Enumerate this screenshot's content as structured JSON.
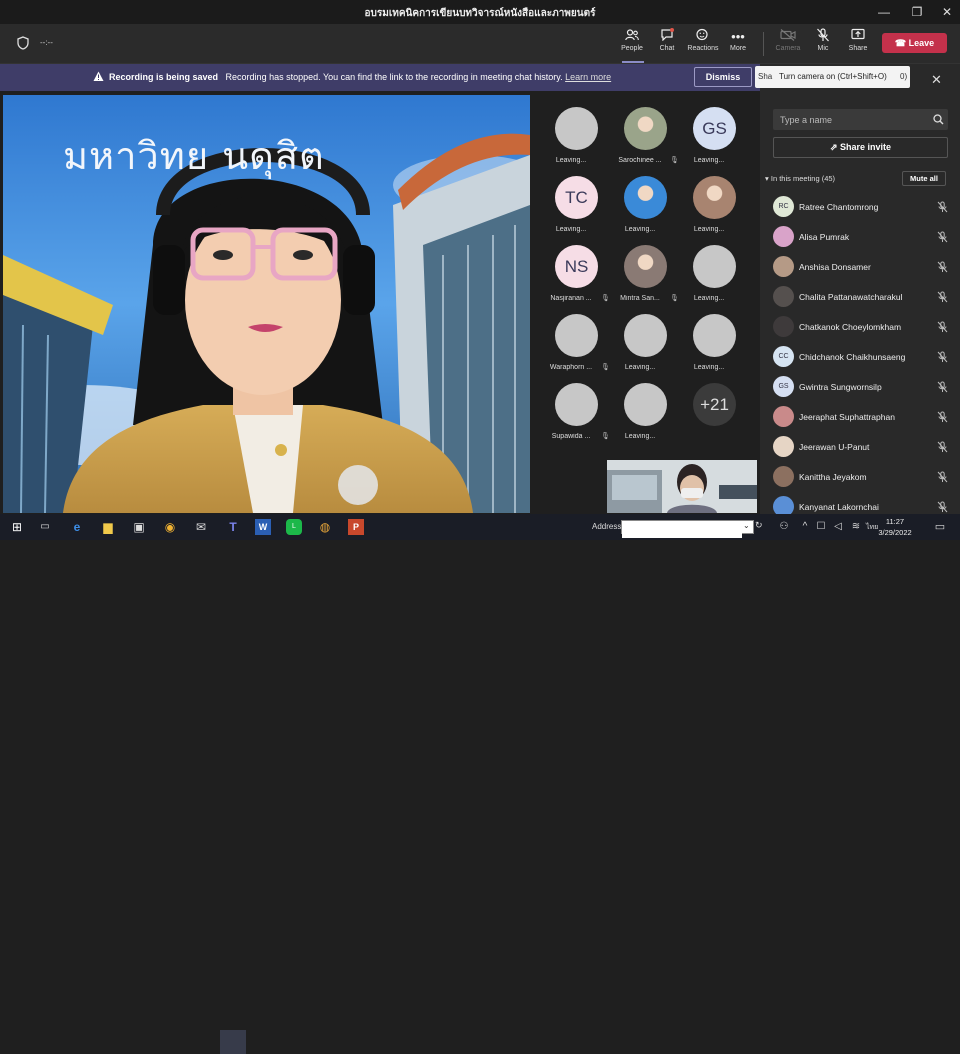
{
  "window": {
    "title": "อบรมเทคนิคการเขียนบทวิจารณ์หนังสือและภาพยนตร์",
    "minimize_glyph": "—",
    "maximize_glyph": "❐",
    "close_glyph": "✕"
  },
  "toolbar": {
    "timer": "--:--",
    "people_label": "People",
    "chat_label": "Chat",
    "reactions_label": "Reactions",
    "more_label": "More",
    "camera_label": "Camera",
    "mic_label": "Mic",
    "share_label": "Share",
    "leave_label": "Leave"
  },
  "banner": {
    "title": "Recording is being saved",
    "message": "Recording has stopped. You can find the link to the recording in meeting chat history.",
    "link": "Learn more",
    "dismiss_label": "Dismiss",
    "background": "#3f3d68"
  },
  "tooltip": {
    "text": "Turn camera on (Ctrl+Shift+O)",
    "partial_left": "Sha",
    "partial_right": "0)"
  },
  "main_video": {
    "sign_text": "มหาวิทย  นดุสิต"
  },
  "grid": [
    {
      "initials": "",
      "name": "Leaving...",
      "mic": false,
      "photo": false
    },
    {
      "initials": "",
      "name": "Sarochinee ...",
      "mic": true,
      "photo": true,
      "color": "#9aa48a"
    },
    {
      "initials": "GS",
      "name": "Leaving...",
      "mic": false,
      "photo": false,
      "bg": "#d5dff2"
    },
    {
      "initials": "TC",
      "name": "Leaving...",
      "mic": false,
      "photo": false,
      "bg": "#f6dde6"
    },
    {
      "initials": "",
      "name": "Leaving...",
      "mic": false,
      "photo": true,
      "color": "#3a8ad8"
    },
    {
      "initials": "",
      "name": "Leaving...",
      "mic": false,
      "photo": true,
      "color": "#a88470"
    },
    {
      "initials": "NS",
      "name": "Nasjiranan ...",
      "mic": true,
      "photo": false,
      "bg": "#f6dde6"
    },
    {
      "initials": "",
      "name": "Mintra San...",
      "mic": true,
      "photo": true,
      "color": "#8a7a74"
    },
    {
      "initials": "",
      "name": "Leaving...",
      "mic": false,
      "photo": false
    },
    {
      "initials": "",
      "name": "Waraphorn ...",
      "mic": true,
      "photo": false
    },
    {
      "initials": "",
      "name": "Leaving...",
      "mic": false,
      "photo": false
    },
    {
      "initials": "",
      "name": "Leaving...",
      "mic": false,
      "photo": false
    },
    {
      "initials": "",
      "name": "Supawida ...",
      "mic": true,
      "photo": false
    },
    {
      "initials": "",
      "name": "Leaving...",
      "mic": false,
      "photo": false
    },
    {
      "initials": "+21",
      "name": "",
      "mic": false,
      "photo": false,
      "bg": "#3b3b3b",
      "fg": "#ddd"
    }
  ],
  "panel": {
    "search_placeholder": "Type a name",
    "share_invite_label": "Share invite",
    "in_meeting_label": "In this meeting (45)",
    "mute_all_label": "Mute all",
    "participants": [
      {
        "name": "Ratree Chantomrong",
        "initials": "RC",
        "bg": "#dfe8d6"
      },
      {
        "name": "Alisa Pumrak",
        "initials": "",
        "bg": "#d9a3c9"
      },
      {
        "name": "Anshisa Donsamer",
        "initials": "",
        "bg": "#b59a86"
      },
      {
        "name": "Chalita Pattanawatcharakul",
        "initials": "",
        "bg": "#55504e"
      },
      {
        "name": "Chatkanok Choeylomkham",
        "initials": "",
        "bg": "#3e3a3b"
      },
      {
        "name": "Chidchanok Chaikhunsaeng",
        "initials": "CC",
        "bg": "#d6e4f2"
      },
      {
        "name": "Gwintra Sungwornsilp",
        "initials": "GS",
        "bg": "#d5dff2"
      },
      {
        "name": "Jeeraphat Suphattraphan",
        "initials": "",
        "bg": "#c98a8a"
      },
      {
        "name": "Jeerawan U-Panut",
        "initials": "",
        "bg": "#e6d5c5"
      },
      {
        "name": "Kanittha Jeyakom",
        "initials": "",
        "bg": "#8c7060"
      },
      {
        "name": "Kanyanat Lakornchai",
        "initials": "",
        "bg": "#5a8fd6"
      }
    ]
  },
  "taskbar": {
    "address_label": "Address",
    "address_value": "",
    "time": "11:27",
    "date": "3/29/2022",
    "language": "ไทย"
  },
  "colors": {
    "leave": "#c4314b",
    "banner": "#3f3d68"
  }
}
